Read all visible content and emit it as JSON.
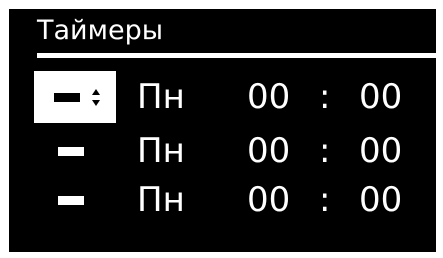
{
  "screen": {
    "title": "Таймеры"
  },
  "timers": [
    {
      "state": "-",
      "day": "Пн",
      "hour": "00",
      "separator": ":",
      "minute": "00",
      "selected": true
    },
    {
      "state": "-",
      "day": "Пн",
      "hour": "00",
      "separator": ":",
      "minute": "00",
      "selected": false
    },
    {
      "state": "-",
      "day": "Пн",
      "hour": "00",
      "separator": ":",
      "minute": "00",
      "selected": false
    }
  ],
  "icons": {
    "stepper": "up-down-arrows-icon"
  },
  "colors": {
    "background": "#000000",
    "foreground": "#ffffff"
  }
}
